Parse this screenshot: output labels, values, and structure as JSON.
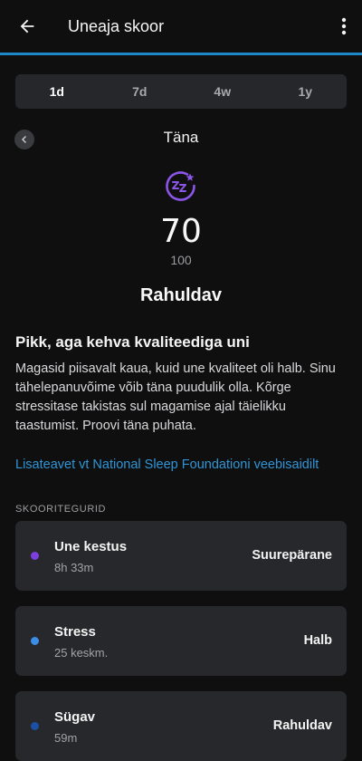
{
  "header": {
    "title": "Uneaja skoor"
  },
  "tabs": [
    {
      "label": "1d",
      "active": true
    },
    {
      "label": "7d",
      "active": false
    },
    {
      "label": "4w",
      "active": false
    },
    {
      "label": "1y",
      "active": false
    }
  ],
  "date": {
    "label": "Täna"
  },
  "score": {
    "value": "70",
    "max": "100",
    "quality": "Rahuldav",
    "icon": "sleep-zz-icon",
    "icon_color": "#8a56e8"
  },
  "summary": {
    "headline": "Pikk, aga kehva kvaliteediga uni",
    "text": "Magasid piisavalt kaua, kuid une kvaliteet oli halb. Sinu tähelepanuvõime võib täna puudulik olla. Kõrge stressitase takistas sul magamise ajal täielikku taastumist. Proovi täna puhata.",
    "link": "Lisateavet vt National Sleep Foundationi veebisaidilt"
  },
  "factors": {
    "title": "SKOORITEGURID",
    "items": [
      {
        "name": "Une kestus",
        "sub": "8h 33m",
        "rating": "Suurepärane",
        "color": "#7b3fe0"
      },
      {
        "name": "Stress",
        "sub": "25 keskm.",
        "rating": "Halb",
        "color": "#3a8ee6"
      },
      {
        "name": "Sügav",
        "sub": "59m",
        "rating": "Rahuldav",
        "color": "#1d4fa3"
      }
    ]
  },
  "colors": {
    "accent": "#1e88c8",
    "background": "#0f0f10",
    "card": "#27282b"
  }
}
